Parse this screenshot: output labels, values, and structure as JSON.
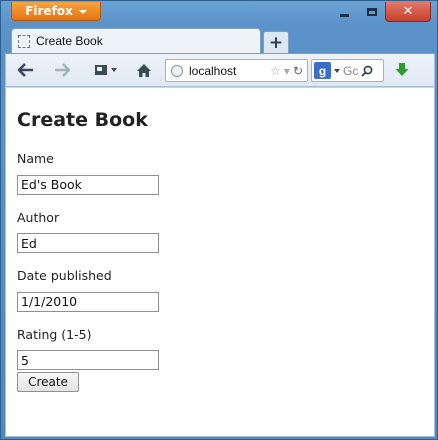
{
  "browser": {
    "app_button": "Firefox",
    "tab_title": "Create Book",
    "new_tab_symbol": "+",
    "url": "localhost",
    "search_placeholder": "Gc"
  },
  "page": {
    "title": "Create Book",
    "fields": [
      {
        "label": "Name",
        "value": "Ed's Book"
      },
      {
        "label": "Author",
        "value": "Ed"
      },
      {
        "label": "Date published",
        "value": "1/1/2010"
      },
      {
        "label": "Rating (1-5)",
        "value": "5"
      }
    ],
    "submit_label": "Create"
  },
  "icons": {
    "back": "back-arrow-icon",
    "forward": "forward-arrow-icon",
    "screenshot": "screenshot-icon",
    "home": "home-icon",
    "star": "bookmark-star-icon",
    "reload": "reload-icon",
    "search": "search-icon",
    "download": "download-arrow-icon"
  },
  "colors": {
    "firefox_button": "#e57510",
    "close_button": "#c7402c",
    "download_arrow": "#2f9a2f"
  }
}
